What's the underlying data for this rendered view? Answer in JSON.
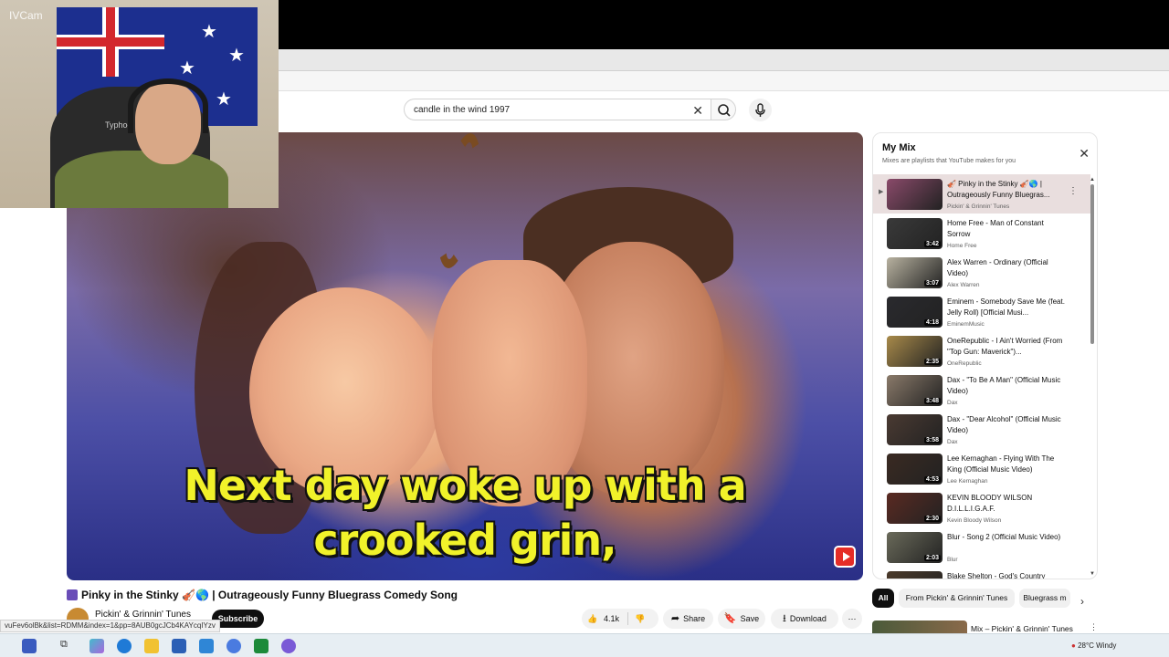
{
  "webcam": {
    "app_label": "IVCam",
    "chair_label": "Typhoo"
  },
  "search": {
    "query": "candle in the wind 1997",
    "clear_icon": "close-icon",
    "search_icon": "search-icon",
    "mic_icon": "mic-icon"
  },
  "player": {
    "caption_line1": "Next day woke up with a",
    "caption_line2": "crooked grin,"
  },
  "video": {
    "title": "Pinky in the Stinky 🎻🌎 | Outrageously Funny Bluegrass Comedy Song",
    "channel": "Pickin' & Grinnin' Tunes",
    "subscribe_label": "Subscribe",
    "likes": "4.1k",
    "share_label": "Share",
    "save_label": "Save",
    "download_label": "Download"
  },
  "status_url": "vuFev6olBk&list=RDMM&index=1&pp=8AUB0gcJCb4KAYcqIYzv",
  "mix": {
    "title": "My Mix",
    "subtitle": "Mixes are playlists that YouTube makes for you",
    "items": [
      {
        "title": "🎻 Pinky in the Stinky 🎻🌎 | Outrageously Funny Bluegras...",
        "channel": "Pickin' & Grinnin' Tunes",
        "duration": "",
        "active": true,
        "color": "#8a4a6a"
      },
      {
        "title": "Home Free - Man of Constant Sorrow",
        "channel": "Home Free",
        "duration": "3:42",
        "color": "#3a3a3a"
      },
      {
        "title": "Alex Warren - Ordinary (Official Video)",
        "channel": "Alex Warren",
        "duration": "3:07",
        "color": "#b8b2a0"
      },
      {
        "title": "Eminem - Somebody Save Me (feat. Jelly Roll) [Official Musi...",
        "channel": "EminemMusic",
        "duration": "4:18",
        "color": "#2a2a2e"
      },
      {
        "title": "OneRepublic - I Ain't Worried (From \"Top Gun: Maverick\")...",
        "channel": "OneRepublic",
        "duration": "2:35",
        "color": "#a88a4a"
      },
      {
        "title": "Dax - \"To Be A Man\" (Official Music Video)",
        "channel": "Dax",
        "duration": "3:48",
        "color": "#8a7a6a"
      },
      {
        "title": "Dax - \"Dear Alcohol\" (Official Music Video)",
        "channel": "Dax",
        "duration": "3:58",
        "color": "#4a3a32"
      },
      {
        "title": "Lee Kernaghan - Flying With The King (Official Music Video)",
        "channel": "Lee Kernaghan",
        "duration": "4:53",
        "color": "#3a2a22"
      },
      {
        "title": "KEVIN BLOODY WILSON D.I.L.L.I.G.A.F.",
        "channel": "Kevin Bloody Wilson",
        "duration": "2:30",
        "color": "#5a2a22"
      },
      {
        "title": "Blur - Song 2 (Official Music Video)",
        "channel": "Blur",
        "duration": "2:03",
        "color": "#6a6a5a"
      },
      {
        "title": "Blake Shelton - God's Country",
        "channel": "",
        "duration": "",
        "color": "#4a3a2a"
      }
    ]
  },
  "chips": [
    "All",
    "From Pickin' & Grinnin' Tunes",
    "Bluegrass m"
  ],
  "next_video": {
    "title": "Mix – Pickin' & Grinnin' Tunes"
  },
  "taskbar": {
    "weather": "28°C  Windy"
  },
  "colors": {
    "accent": "#0f0f0f",
    "active_row": "#e9dede",
    "caption": "#f1f22a"
  }
}
